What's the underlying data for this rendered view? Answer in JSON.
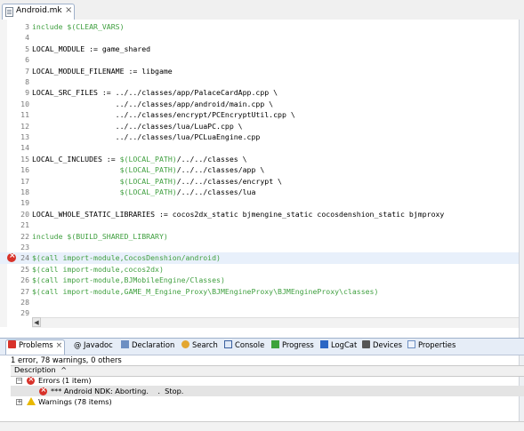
{
  "editor": {
    "tab_label": "Android.mk",
    "lines": [
      {
        "num": "3",
        "text": "include $(CLEAR_VARS)",
        "kind": "green"
      },
      {
        "num": "4",
        "text": "",
        "kind": "plain"
      },
      {
        "num": "5",
        "text": "LOCAL_MODULE := game_shared",
        "kind": "plain"
      },
      {
        "num": "6",
        "text": "",
        "kind": "plain"
      },
      {
        "num": "7",
        "text": "LOCAL_MODULE_FILENAME := libgame",
        "kind": "plain"
      },
      {
        "num": "8",
        "text": "",
        "kind": "plain"
      },
      {
        "num": "9",
        "text": "LOCAL_SRC_FILES := ../../classes/app/PalaceCardApp.cpp \\",
        "kind": "plain"
      },
      {
        "num": "10",
        "text": "                   ../../classes/app/android/main.cpp \\",
        "kind": "plain"
      },
      {
        "num": "11",
        "text": "                   ../../classes/encrypt/PCEncryptUtil.cpp \\",
        "kind": "plain"
      },
      {
        "num": "12",
        "text": "                   ../../classes/lua/LuaPC.cpp \\",
        "kind": "plain"
      },
      {
        "num": "13",
        "text": "                   ../../classes/lua/PCLuaEngine.cpp",
        "kind": "plain"
      },
      {
        "num": "14",
        "text": "",
        "kind": "plain"
      },
      {
        "num": "15",
        "text": "LOCAL_C_INCLUDES := $(LOCAL_PATH)/../../classes \\",
        "kind": "mixed"
      },
      {
        "num": "16",
        "text": "                    $(LOCAL_PATH)/../../classes/app \\",
        "kind": "mixed"
      },
      {
        "num": "17",
        "text": "                    $(LOCAL_PATH)/../../classes/encrypt \\",
        "kind": "mixed"
      },
      {
        "num": "18",
        "text": "                    $(LOCAL_PATH)/../../classes/lua",
        "kind": "mixed"
      },
      {
        "num": "19",
        "text": "",
        "kind": "plain"
      },
      {
        "num": "20",
        "text": "LOCAL_WHOLE_STATIC_LIBRARIES := cocos2dx_static bjmengine_static cocosdenshion_static bjmproxy",
        "kind": "plain"
      },
      {
        "num": "21",
        "text": "",
        "kind": "plain"
      },
      {
        "num": "22",
        "text": "include $(BUILD_SHARED_LIBRARY)",
        "kind": "green"
      },
      {
        "num": "23",
        "text": "",
        "kind": "plain"
      },
      {
        "num": "24",
        "text": "$(call import-module,CocosDenshion/android)",
        "kind": "green",
        "error": true,
        "highlight": true
      },
      {
        "num": "25",
        "text": "$(call import-module,cocos2dx)",
        "kind": "green"
      },
      {
        "num": "26",
        "text": "$(call import-module,BJMobileEngine/Classes)",
        "kind": "green"
      },
      {
        "num": "27",
        "text": "$(call import-module,GAME_M_Engine_Proxy\\BJMEngineProxy\\BJMEngineProxy\\classes)",
        "kind": "green"
      },
      {
        "num": "28",
        "text": "",
        "kind": "plain"
      },
      {
        "num": "29",
        "text": "",
        "kind": "plain"
      }
    ]
  },
  "panel": {
    "tabs": [
      {
        "label": "Problems",
        "icon": "problems-icon",
        "active": true
      },
      {
        "label": "@ Javadoc",
        "icon": "",
        "active": false
      },
      {
        "label": "Declaration",
        "icon": "declaration-icon",
        "active": false
      },
      {
        "label": "Search",
        "icon": "search-icon",
        "active": false
      },
      {
        "label": "Console",
        "icon": "console-icon",
        "active": false
      },
      {
        "label": "Progress",
        "icon": "progress-icon",
        "active": false
      },
      {
        "label": "LogCat",
        "icon": "logcat-icon",
        "active": false
      },
      {
        "label": "Devices",
        "icon": "devices-icon",
        "active": false
      },
      {
        "label": "Properties",
        "icon": "properties-icon",
        "active": false
      }
    ],
    "summary": "1 error, 78 warnings, 0 others",
    "column_header": "Description",
    "sort_indicator": "^",
    "errors_group": "Errors (1 item)",
    "error_item": "*** Android NDK: Aborting.    .  Stop.",
    "warnings_group": "Warnings (78 items)"
  },
  "colors": {
    "green_text": "#3f9f3f",
    "error_red": "#d8322a",
    "warning_yellow": "#e8b800",
    "highlight_line": "#e8f0fb"
  }
}
